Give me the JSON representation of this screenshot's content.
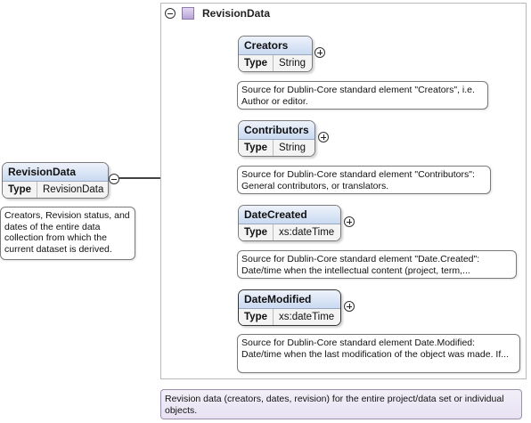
{
  "root": {
    "name": "RevisionData",
    "type_key": "Type",
    "type_value": "RevisionData",
    "note": "Creators, Revision status, and dates of the entire data collection from which the current dataset is derived."
  },
  "container": {
    "title": "RevisionData",
    "footer_note": "Revision data (creators, dates, revision) for the entire project/data set or individual objects."
  },
  "children": [
    {
      "name": "Creators",
      "type_key": "Type",
      "type_value": "String",
      "note": "Source for Dublin-Core standard element \"Creators\", i.e. Author or editor."
    },
    {
      "name": "Contributors",
      "type_key": "Type",
      "type_value": "String",
      "note": "Source for Dublin-Core standard element \"Contributors\": General contributors, or translators."
    },
    {
      "name": "DateCreated",
      "type_key": "Type",
      "type_value": "xs:dateTime",
      "note": "Source for Dublin-Core standard element \"Date.Created\": Date/time when the intellectual content (project, term,..."
    },
    {
      "name": "DateModified",
      "type_key": "Type",
      "type_value": "xs:dateTime",
      "note": "Source for Dublin-Core standard element Date.Modified: Date/time when the last modification of the object was made. If..."
    }
  ],
  "icons": {
    "collapse": "collapse-icon",
    "expand": "expand-icon",
    "complex_type": "complex-type-icon",
    "sequence": "sequence-compositor-icon"
  },
  "colors": {
    "element_header": "#c9d9f1",
    "footer_note_bg": "#e8e2f3",
    "sequence_icon": "#f1e6a0"
  }
}
